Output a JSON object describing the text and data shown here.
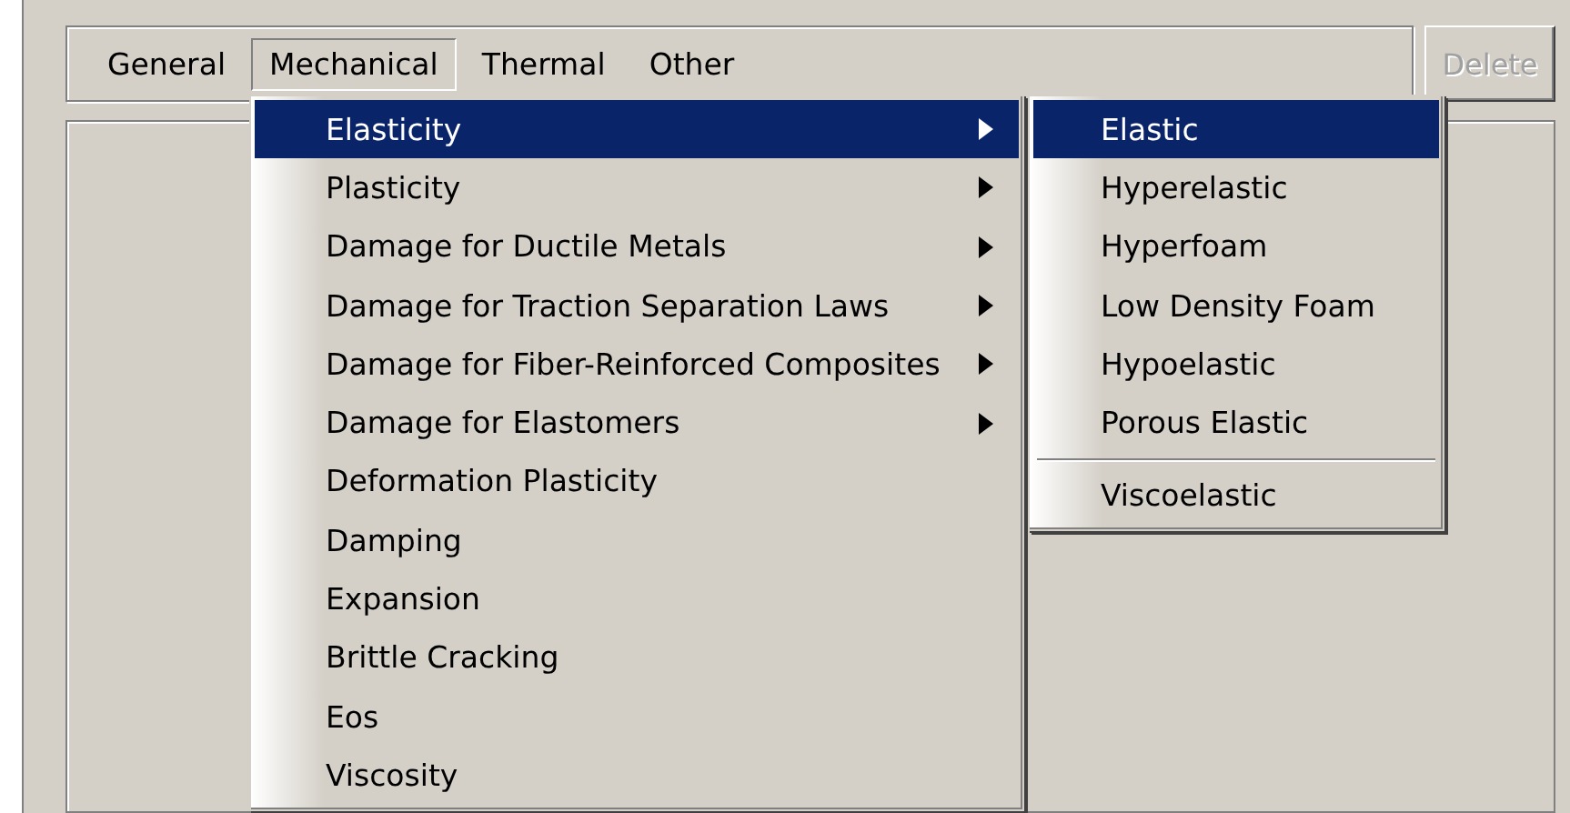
{
  "menu_bar": [
    {
      "label": "General",
      "selected": false
    },
    {
      "label": "Mechanical",
      "selected": true
    },
    {
      "label": "Thermal",
      "selected": false
    },
    {
      "label": "Other",
      "selected": false
    }
  ],
  "delete_button": {
    "label": "Delete",
    "disabled": true
  },
  "dropdown": [
    {
      "label": "Elasticity",
      "submenu": true,
      "selected": true
    },
    {
      "label": "Plasticity",
      "submenu": true,
      "selected": false
    },
    {
      "label": "Damage for Ductile Metals",
      "submenu": true,
      "selected": false
    },
    {
      "label": "Damage for Traction Separation Laws",
      "submenu": true,
      "selected": false
    },
    {
      "label": "Damage for Fiber-Reinforced Composites",
      "submenu": true,
      "selected": false
    },
    {
      "label": "Damage for Elastomers",
      "submenu": true,
      "selected": false
    },
    {
      "label": "Deformation Plasticity",
      "submenu": false,
      "selected": false
    },
    {
      "label": "Damping",
      "submenu": false,
      "selected": false
    },
    {
      "label": "Expansion",
      "submenu": false,
      "selected": false
    },
    {
      "label": "Brittle Cracking",
      "submenu": false,
      "selected": false
    },
    {
      "label": "Eos",
      "submenu": false,
      "selected": false
    },
    {
      "label": "Viscosity",
      "submenu": false,
      "selected": false
    }
  ],
  "submenu_groups": [
    {
      "items": [
        {
          "label": "Elastic",
          "selected": true
        },
        {
          "label": "Hyperelastic",
          "selected": false
        },
        {
          "label": "Hyperfoam",
          "selected": false
        },
        {
          "label": "Low Density Foam",
          "selected": false
        },
        {
          "label": "Hypoelastic",
          "selected": false
        },
        {
          "label": "Porous Elastic",
          "selected": false
        }
      ]
    },
    {
      "items": [
        {
          "label": "Viscoelastic",
          "selected": false
        }
      ]
    }
  ]
}
